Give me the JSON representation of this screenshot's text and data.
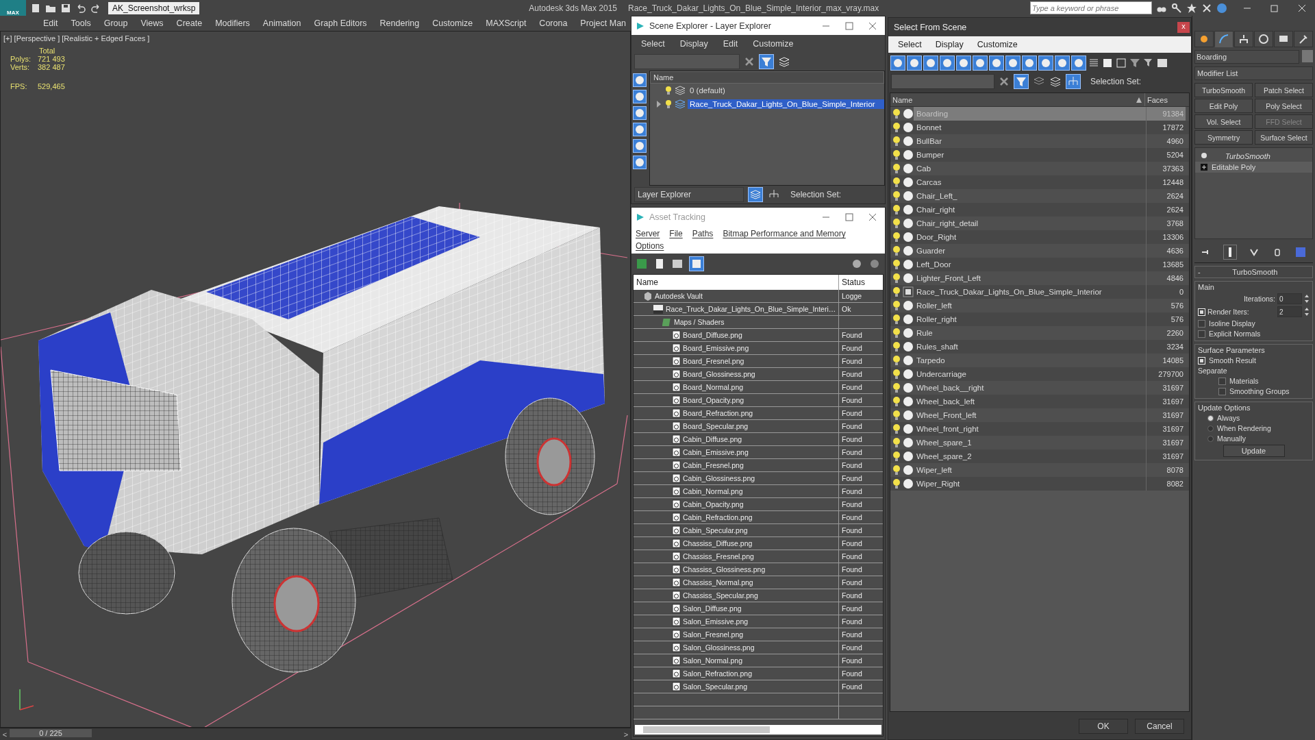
{
  "app": {
    "workspace": "AK_Screenshot_wrksp",
    "product": "Autodesk 3ds Max  2015",
    "file": "Race_Truck_Dakar_Lights_On_Blue_Simple_Interior_max_vray.max",
    "search_placeholder": "Type a keyword or phrase",
    "logo": "MAX"
  },
  "menu": [
    "Edit",
    "Tools",
    "Group",
    "Views",
    "Create",
    "Modifiers",
    "Animation",
    "Graph Editors",
    "Rendering",
    "Customize",
    "MAXScript",
    "Corona",
    "Project Man"
  ],
  "viewport": {
    "label": "[+] [Perspective ] [Realistic + Edged Faces ]",
    "stats_title": "Total",
    "stats": [
      {
        "label": "Polys:",
        "value": "721 493"
      },
      {
        "label": "Verts:",
        "value": "382 487"
      }
    ],
    "fps_label": "FPS:",
    "fps": "529,465"
  },
  "time_slider": {
    "frame": "0 / 225",
    "level": 0,
    "prev": "<",
    "next": ">"
  },
  "scene_explorer": {
    "title": "Scene Explorer - Layer Explorer",
    "menu": [
      "Select",
      "Display",
      "Edit",
      "Customize"
    ],
    "column": "Name",
    "layers": [
      {
        "name": "0 (default)",
        "selected": false,
        "expandable": false
      },
      {
        "name": "Race_Truck_Dakar_Lights_On_Blue_Simple_Interior",
        "selected": true,
        "expandable": true
      }
    ],
    "mode": "Layer Explorer",
    "selection_set": "Selection Set:"
  },
  "asset_tracking": {
    "title": "Asset Tracking",
    "menu": [
      "Server",
      "File",
      "Paths",
      "Bitmap Performance and Memory",
      "Options"
    ],
    "columns": [
      "Name",
      "Status"
    ],
    "tree": [
      {
        "kind": "vault",
        "name": "Autodesk Vault",
        "status": "Logge",
        "children": [
          {
            "kind": "file",
            "name": "Race_Truck_Dakar_Lights_On_Blue_Simple_Interi…",
            "status": "Ok",
            "children": [
              {
                "kind": "folder",
                "name": "Maps / Shaders",
                "children": [
                  {
                    "kind": "bitmap",
                    "name": "Board_Diffuse.png",
                    "status": "Found"
                  },
                  {
                    "kind": "bitmap",
                    "name": "Board_Emissive.png",
                    "status": "Found"
                  },
                  {
                    "kind": "bitmap",
                    "name": "Board_Fresnel.png",
                    "status": "Found"
                  },
                  {
                    "kind": "bitmap",
                    "name": "Board_Glossiness.png",
                    "status": "Found"
                  },
                  {
                    "kind": "bitmap",
                    "name": "Board_Normal.png",
                    "status": "Found"
                  },
                  {
                    "kind": "bitmap",
                    "name": "Board_Opacity.png",
                    "status": "Found"
                  },
                  {
                    "kind": "bitmap",
                    "name": "Board_Refraction.png",
                    "status": "Found"
                  },
                  {
                    "kind": "bitmap",
                    "name": "Board_Specular.png",
                    "status": "Found"
                  },
                  {
                    "kind": "bitmap",
                    "name": "Cabin_Diffuse.png",
                    "status": "Found"
                  },
                  {
                    "kind": "bitmap",
                    "name": "Cabin_Emissive.png",
                    "status": "Found"
                  },
                  {
                    "kind": "bitmap",
                    "name": "Cabin_Fresnel.png",
                    "status": "Found"
                  },
                  {
                    "kind": "bitmap",
                    "name": "Cabin_Glossiness.png",
                    "status": "Found"
                  },
                  {
                    "kind": "bitmap",
                    "name": "Cabin_Normal.png",
                    "status": "Found"
                  },
                  {
                    "kind": "bitmap",
                    "name": "Cabin_Opacity.png",
                    "status": "Found"
                  },
                  {
                    "kind": "bitmap",
                    "name": "Cabin_Refraction.png",
                    "status": "Found"
                  },
                  {
                    "kind": "bitmap",
                    "name": "Cabin_Specular.png",
                    "status": "Found"
                  },
                  {
                    "kind": "bitmap",
                    "name": "Chassiss_Diffuse.png",
                    "status": "Found"
                  },
                  {
                    "kind": "bitmap",
                    "name": "Chassiss_Fresnel.png",
                    "status": "Found"
                  },
                  {
                    "kind": "bitmap",
                    "name": "Chassiss_Glossiness.png",
                    "status": "Found"
                  },
                  {
                    "kind": "bitmap",
                    "name": "Chassiss_Normal.png",
                    "status": "Found"
                  },
                  {
                    "kind": "bitmap",
                    "name": "Chassiss_Specular.png",
                    "status": "Found"
                  },
                  {
                    "kind": "bitmap",
                    "name": "Salon_Diffuse.png",
                    "status": "Found"
                  },
                  {
                    "kind": "bitmap",
                    "name": "Salon_Emissive.png",
                    "status": "Found"
                  },
                  {
                    "kind": "bitmap",
                    "name": "Salon_Fresnel.png",
                    "status": "Found"
                  },
                  {
                    "kind": "bitmap",
                    "name": "Salon_Glossiness.png",
                    "status": "Found"
                  },
                  {
                    "kind": "bitmap",
                    "name": "Salon_Normal.png",
                    "status": "Found"
                  },
                  {
                    "kind": "bitmap",
                    "name": "Salon_Refraction.png",
                    "status": "Found"
                  },
                  {
                    "kind": "bitmap",
                    "name": "Salon_Specular.png",
                    "status": "Found"
                  }
                ]
              }
            ]
          }
        ]
      }
    ]
  },
  "select_from_scene": {
    "title": "Select From Scene",
    "close": "x",
    "menu": [
      "Select",
      "Display",
      "Customize"
    ],
    "selection_set": "Selection Set:",
    "columns": [
      "Name",
      "Faces"
    ],
    "objects": [
      {
        "kind": "object",
        "name": "Boarding",
        "faces": "91384",
        "selected": true
      },
      {
        "kind": "object",
        "name": "Bonnet",
        "faces": "17872",
        "selected": false
      },
      {
        "kind": "object",
        "name": "BullBar",
        "faces": "4960",
        "selected": false
      },
      {
        "kind": "object",
        "name": "Bumper",
        "faces": "5204",
        "selected": false
      },
      {
        "kind": "object",
        "name": "Cab",
        "faces": "37363",
        "selected": false
      },
      {
        "kind": "object",
        "name": "Carcas",
        "faces": "12448",
        "selected": false
      },
      {
        "kind": "object",
        "name": "Chair_Left_",
        "faces": "2624",
        "selected": false
      },
      {
        "kind": "object",
        "name": "Chair_right",
        "faces": "2624",
        "selected": false
      },
      {
        "kind": "object",
        "name": "Chair_right_detail",
        "faces": "3768",
        "selected": false
      },
      {
        "kind": "object",
        "name": "Door_Right",
        "faces": "13306",
        "selected": false
      },
      {
        "kind": "object",
        "name": "Guarder",
        "faces": "4636",
        "selected": false
      },
      {
        "kind": "object",
        "name": "Left_Door",
        "faces": "13685",
        "selected": false
      },
      {
        "kind": "object",
        "name": "Lighter_Front_Left",
        "faces": "4846",
        "selected": false
      },
      {
        "kind": "group",
        "name": "Race_Truck_Dakar_Lights_On_Blue_Simple_Interior",
        "faces": "0",
        "selected": false
      },
      {
        "kind": "object",
        "name": "Roller_left",
        "faces": "576",
        "selected": false
      },
      {
        "kind": "object",
        "name": "Roller_right",
        "faces": "576",
        "selected": false
      },
      {
        "kind": "object",
        "name": "Rule",
        "faces": "2260",
        "selected": false
      },
      {
        "kind": "object",
        "name": "Rules_shaft",
        "faces": "3234",
        "selected": false
      },
      {
        "kind": "object",
        "name": "Tarpedo",
        "faces": "14085",
        "selected": false
      },
      {
        "kind": "object",
        "name": "Undercarriage",
        "faces": "279700",
        "selected": false
      },
      {
        "kind": "object",
        "name": "Wheel_back__right",
        "faces": "31697",
        "selected": false
      },
      {
        "kind": "object",
        "name": "Wheel_back_left",
        "faces": "31697",
        "selected": false
      },
      {
        "kind": "object",
        "name": "Wheel_Front_left",
        "faces": "31697",
        "selected": false
      },
      {
        "kind": "object",
        "name": "Wheel_front_right",
        "faces": "31697",
        "selected": false
      },
      {
        "kind": "object",
        "name": "Wheel_spare_1",
        "faces": "31697",
        "selected": false
      },
      {
        "kind": "object",
        "name": "Wheel_spare_2",
        "faces": "31697",
        "selected": false
      },
      {
        "kind": "object",
        "name": "Wiper_left",
        "faces": "8078",
        "selected": false
      },
      {
        "kind": "object",
        "name": "Wiper_Right",
        "faces": "8082",
        "selected": false
      }
    ],
    "buttons": [
      "OK",
      "Cancel"
    ]
  },
  "command_panel": {
    "tabs": [
      {
        "selected": false
      },
      {
        "selected": true
      },
      {
        "selected": false
      },
      {
        "selected": false
      },
      {
        "selected": false
      },
      {
        "selected": false
      }
    ],
    "object_name": "Boarding",
    "modifier_list": "Modifier List",
    "modifier_buttons": [
      {
        "label": "TurboSmooth",
        "disabled": false
      },
      {
        "label": "Patch Select",
        "disabled": false
      },
      {
        "label": "Edit Poly",
        "disabled": false
      },
      {
        "label": "Poly Select",
        "disabled": false
      },
      {
        "label": "Vol. Select",
        "disabled": false
      },
      {
        "label": "FFD Select",
        "disabled": true
      },
      {
        "label": "Symmetry",
        "disabled": false
      },
      {
        "label": "Surface Select",
        "disabled": false
      }
    ],
    "stack": [
      {
        "kind": "modifier",
        "name": "TurboSmooth",
        "selected": false
      },
      {
        "kind": "base",
        "name": "Editable Poly",
        "selected": true
      }
    ],
    "rollout": {
      "toggle": "-",
      "title": "TurboSmooth",
      "groups": [
        {
          "title": "Main",
          "items": [
            {
              "kind": "spinner",
              "label": "Iterations:",
              "value": "0"
            },
            {
              "kind": "checkspinner",
              "label": "Render Iters:",
              "value": "2",
              "checked": true
            },
            {
              "kind": "checkbox",
              "label": "Isoline Display",
              "checked": false
            },
            {
              "kind": "checkbox",
              "label": "Explicit Normals",
              "checked": false
            }
          ]
        },
        {
          "title": "Surface Parameters",
          "items": [
            {
              "kind": "checkbox",
              "label": "Smooth Result",
              "checked": true
            },
            {
              "kind": "label",
              "label": "Separate"
            },
            {
              "kind": "subcheckbox",
              "label": "Materials",
              "checked": false
            },
            {
              "kind": "subcheckbox",
              "label": "Smoothing Groups",
              "checked": false
            }
          ]
        },
        {
          "title": "Update Options",
          "items": [
            {
              "kind": "radio",
              "label": "Always",
              "selected": true
            },
            {
              "kind": "radio",
              "label": "When Rendering",
              "selected": false
            },
            {
              "kind": "radio",
              "label": "Manually",
              "selected": false
            },
            {
              "kind": "button",
              "label": "Update"
            }
          ]
        }
      ]
    }
  }
}
